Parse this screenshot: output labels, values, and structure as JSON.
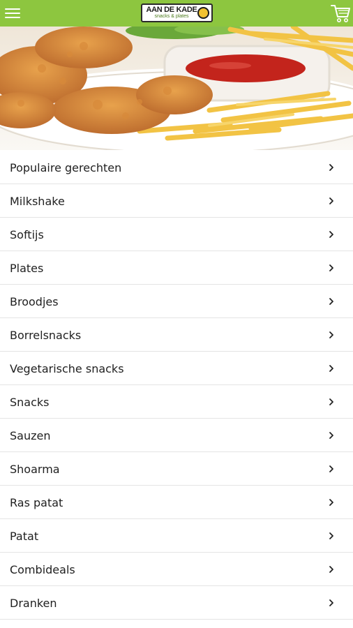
{
  "header": {
    "menu_icon": "hamburger-menu-icon",
    "logo": {
      "title": "AAN DE KADE",
      "subtitle": "snacks & plates"
    },
    "cart_icon": "shopping-cart-icon",
    "bar_color": "#8dc63f"
  },
  "hero": {
    "image": "fried chicken tenders, french fries and ketchup on a plate"
  },
  "menu": {
    "chevron_icon": "chevron-right-icon",
    "items": [
      {
        "label": "Populaire gerechten"
      },
      {
        "label": "Milkshake"
      },
      {
        "label": "Softijs"
      },
      {
        "label": "Plates"
      },
      {
        "label": "Broodjes"
      },
      {
        "label": "Borrelsnacks"
      },
      {
        "label": "Vegetarische snacks"
      },
      {
        "label": "Snacks"
      },
      {
        "label": "Sauzen"
      },
      {
        "label": "Shoarma"
      },
      {
        "label": "Ras patat"
      },
      {
        "label": "Patat"
      },
      {
        "label": "Combideals"
      },
      {
        "label": "Dranken"
      }
    ]
  }
}
